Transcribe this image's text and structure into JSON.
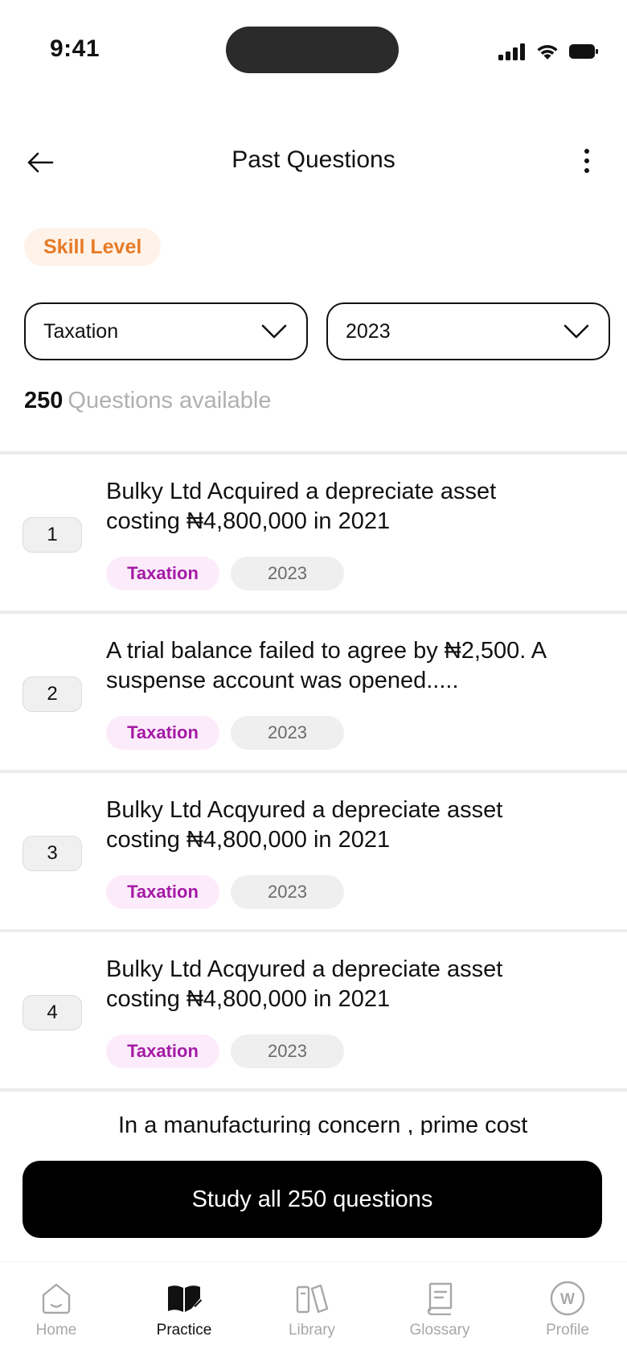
{
  "status_bar": {
    "time": "9:41"
  },
  "header": {
    "title": "Past Questions"
  },
  "skill_level": {
    "label": "Skill Level"
  },
  "filters": {
    "subject": {
      "value": "Taxation"
    },
    "year": {
      "value": "2023"
    }
  },
  "summary": {
    "count": "250",
    "text": "Questions available"
  },
  "questions": [
    {
      "number": "1",
      "line1": "Bulky Ltd Acquired a depreciate asset",
      "line2": "costing ₦4,800,000 in 2021",
      "subject": "Taxation",
      "year": "2023"
    },
    {
      "number": "2",
      "line1": "A trial balance failed to agree by ₦2,500. A",
      "line2": "suspense account was opened.....",
      "subject": "Taxation",
      "year": "2023"
    },
    {
      "number": "3",
      "line1": "Bulky Ltd Acqyured a depreciate asset",
      "line2": "costing ₦4,800,000 in 2021",
      "subject": "Taxation",
      "year": "2023"
    },
    {
      "number": "4",
      "line1": "Bulky Ltd Acqyured a depreciate asset",
      "line2": "costing ₦4,800,000 in 2021",
      "subject": "Taxation",
      "year": "2023"
    },
    {
      "line1": "In a manufacturing concern , prime cost"
    }
  ],
  "study_button": {
    "label": "Study all 250 questions"
  },
  "tabs": [
    {
      "label": "Home",
      "icon": "home-icon",
      "active": false
    },
    {
      "label": "Practice",
      "icon": "book-open-icon",
      "active": true
    },
    {
      "label": "Library",
      "icon": "library-icon",
      "active": false
    },
    {
      "label": "Glossary",
      "icon": "glossary-icon",
      "active": false
    },
    {
      "label": "Profile",
      "icon": "profile-icon",
      "avatar_letter": "W",
      "active": false
    }
  ],
  "colors": {
    "accent_orange": "#e77b27",
    "badge_orange_bg": "#fff3e9",
    "tag_purple": "#a41aa6",
    "tag_purple_bg": "#fcecfb",
    "primary_button": "#000000"
  }
}
